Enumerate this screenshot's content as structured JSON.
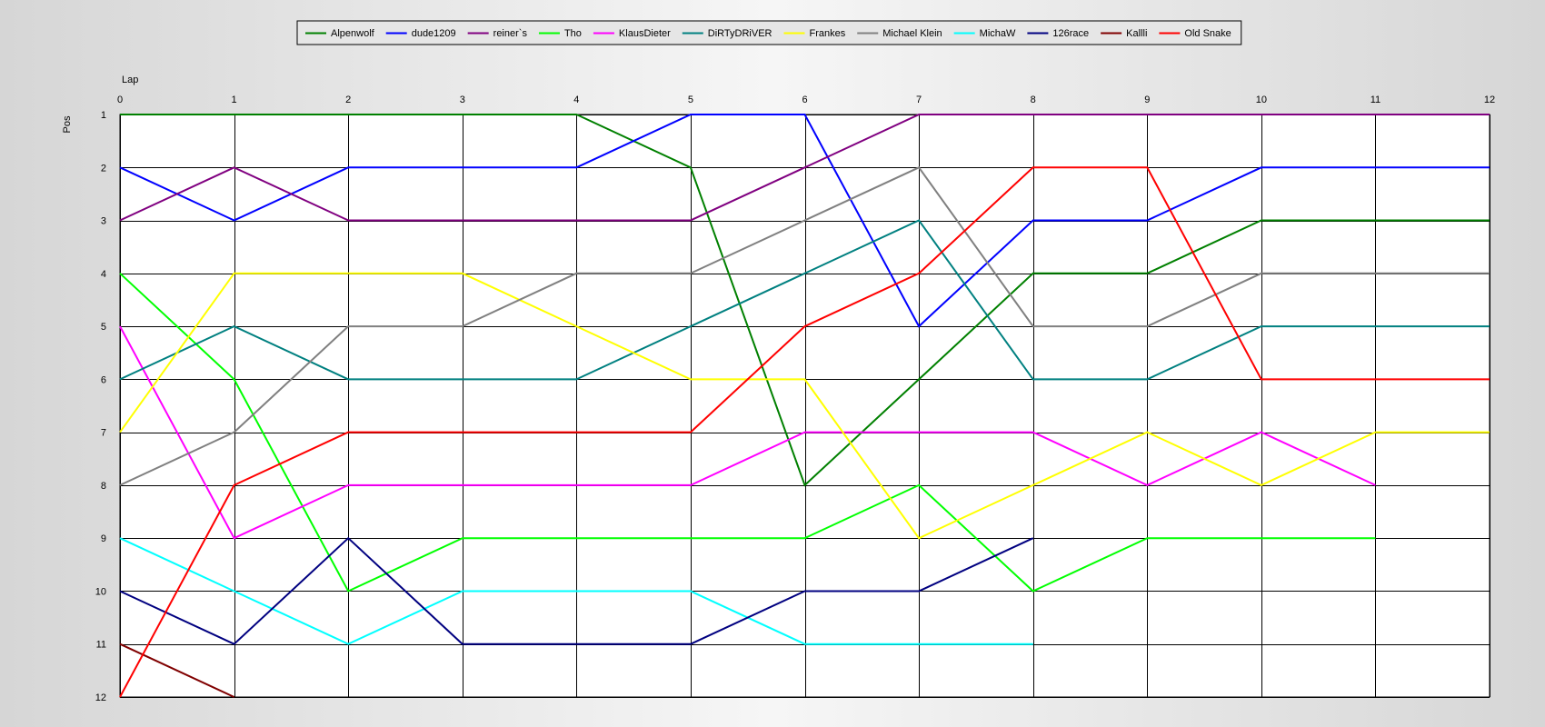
{
  "chart_data": {
    "type": "line",
    "xlabel": "Lap",
    "ylabel": "Pos",
    "x": [
      0,
      1,
      2,
      3,
      4,
      5,
      6,
      7,
      8,
      9,
      10,
      11,
      12
    ],
    "y_ticks": [
      1,
      2,
      3,
      4,
      5,
      6,
      7,
      8,
      9,
      10,
      11,
      12
    ],
    "xlim": [
      0,
      12
    ],
    "ylim": [
      1,
      12
    ],
    "y_inverted": true,
    "grid": true,
    "legend_position": "top-center",
    "series": [
      {
        "name": "Alpenwolf",
        "color": "#008000",
        "values": [
          1,
          1,
          1,
          1,
          1,
          2,
          8,
          6,
          4,
          4,
          3,
          3,
          3
        ]
      },
      {
        "name": "dude1209",
        "color": "#0000ff",
        "values": [
          2,
          3,
          2,
          2,
          2,
          1,
          1,
          5,
          3,
          3,
          2,
          2,
          2
        ]
      },
      {
        "name": "reiner`s",
        "color": "#800080",
        "values": [
          3,
          2,
          3,
          3,
          3,
          3,
          2,
          1,
          1,
          1,
          1,
          1,
          1
        ]
      },
      {
        "name": "Tho",
        "color": "#00ff00",
        "values": [
          4,
          6,
          10,
          9,
          9,
          9,
          9,
          8,
          10,
          9,
          9,
          9,
          null
        ]
      },
      {
        "name": "KlausDieter",
        "color": "#ff00ff",
        "values": [
          5,
          9,
          8,
          8,
          8,
          8,
          7,
          7,
          7,
          8,
          7,
          8,
          null
        ]
      },
      {
        "name": "DiRTyDRiVER",
        "color": "#008080",
        "values": [
          6,
          5,
          6,
          6,
          6,
          5,
          4,
          3,
          6,
          6,
          5,
          5,
          5
        ]
      },
      {
        "name": "Frankes",
        "color": "#ffff00",
        "values": [
          7,
          4,
          4,
          4,
          5,
          6,
          6,
          9,
          8,
          7,
          8,
          7,
          7
        ]
      },
      {
        "name": "Michael Klein",
        "color": "#808080",
        "values": [
          8,
          7,
          5,
          5,
          4,
          4,
          3,
          2,
          5,
          5,
          4,
          4,
          4
        ]
      },
      {
        "name": "MichaW",
        "color": "#00ffff",
        "values": [
          9,
          10,
          11,
          10,
          10,
          10,
          11,
          11,
          11,
          null,
          null,
          null,
          null
        ]
      },
      {
        "name": "126race",
        "color": "#000080",
        "values": [
          10,
          11,
          9,
          11,
          11,
          11,
          10,
          10,
          9,
          null,
          null,
          null,
          null
        ]
      },
      {
        "name": "Kallli",
        "color": "#800000",
        "values": [
          11,
          12,
          null,
          null,
          null,
          null,
          null,
          null,
          null,
          null,
          null,
          null,
          null
        ]
      },
      {
        "name": "Old Snake",
        "color": "#ff0000",
        "values": [
          12,
          8,
          7,
          7,
          7,
          7,
          5,
          4,
          2,
          2,
          6,
          6,
          6
        ]
      }
    ]
  }
}
